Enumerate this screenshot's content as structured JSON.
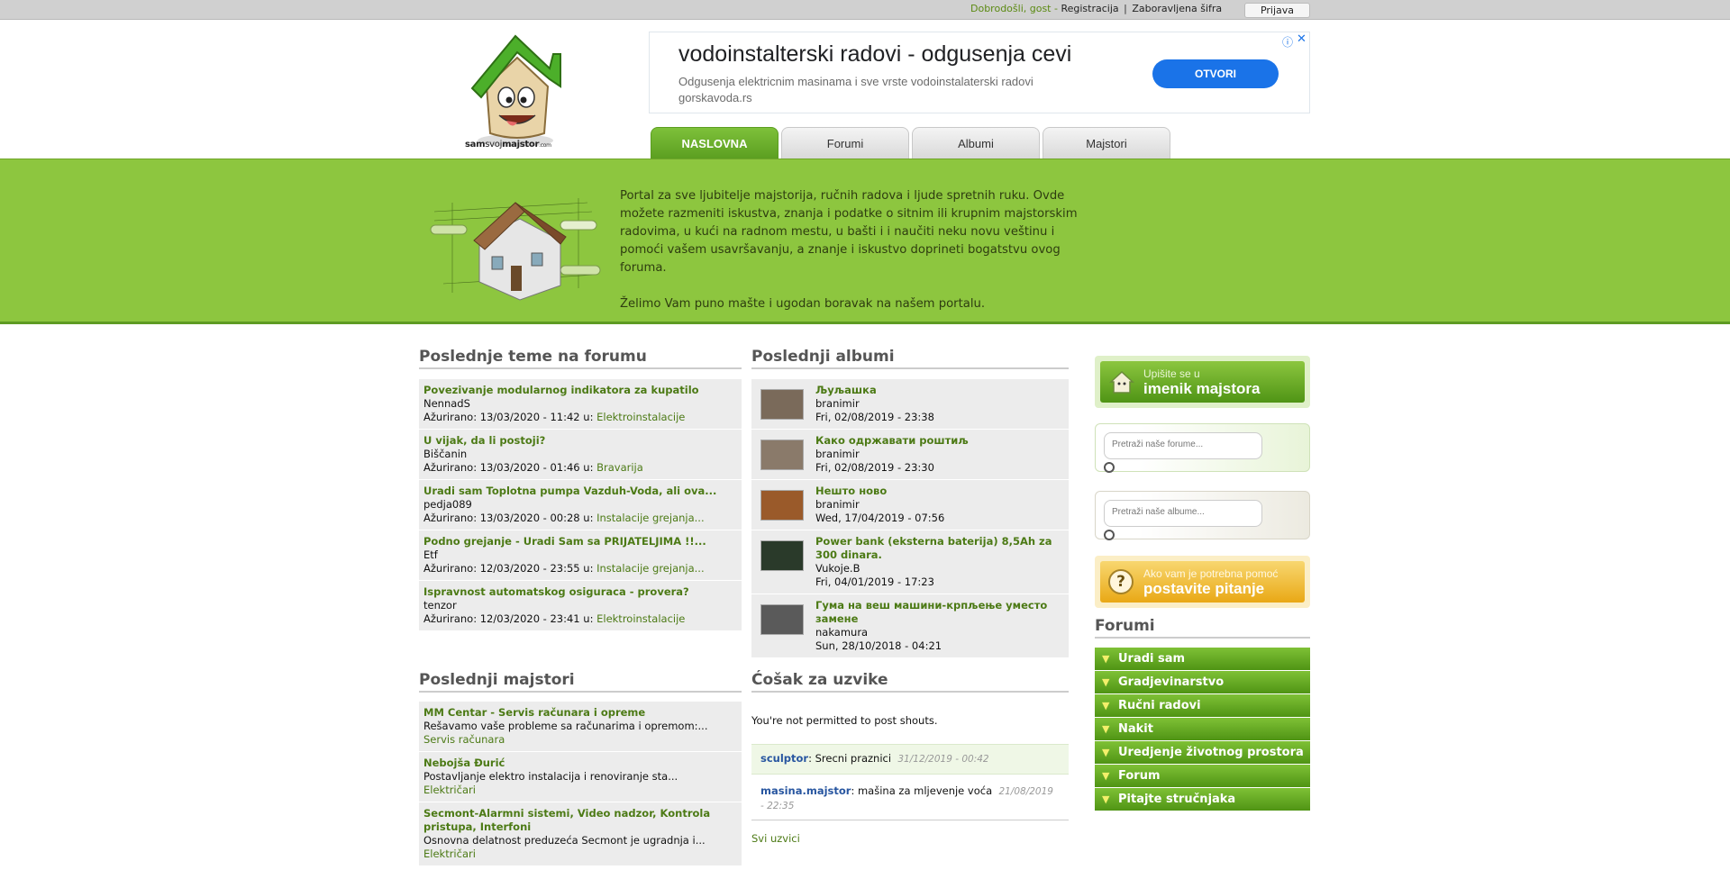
{
  "topbar": {
    "welcome": "Dobrodošli, gost -",
    "register": "Registracija",
    "separator": "|",
    "forgot": "Zaboravljena šifra",
    "login": "Prijava"
  },
  "logo": {
    "part1": "sam",
    "part2": "svoj",
    "part3": "majstor",
    "part4": ".com"
  },
  "ad": {
    "title": "vodoinstalterski radovi - odgusenja cevi",
    "description": "Odgusenja elektricnim masinama i sve vrste vodoinstalaterski radovi",
    "url": "gorskavoda.rs",
    "button": "OTVORI",
    "info_icon": "ⓘ",
    "close_icon": "✕"
  },
  "tabs": [
    "NASLOVNA",
    "Forumi",
    "Albumi",
    "Majstori"
  ],
  "intro": {
    "p1": "Portal za sve ljubitelje majstorija, ručnih radova i ljude spretnih ruku. Ovde možete razmeniti iskustva, znanja i podatke o sitnim ili krupnim majstorskim radovima, u kući na radnom mestu, u bašti i i naučiti neku novu veštinu i pomoći vašem usavršavanju, a znanje i iskustvo doprineti bogatstvu ovog foruma.",
    "p2": "Želimo Vam puno mašte i ugodan boravak na našem portalu."
  },
  "forum_topics": {
    "title": "Poslednje teme na forumu",
    "items": [
      {
        "title": "Povezivanje modularnog indikatora za kupatilo",
        "user": "NennadS",
        "updated": "Ažurirano: 13/03/2020 - 11:42 u: ",
        "category": "Elektroinstalacije"
      },
      {
        "title": "U vijak, da li postoji?",
        "user": "Biščanin",
        "updated": "Ažurirano: 13/03/2020 - 01:46 u: ",
        "category": "Bravarija"
      },
      {
        "title": "Uradi sam Toplotna pumpa Vazduh-Voda, ali ova...",
        "user": "pedja089",
        "updated": "Ažurirano: 13/03/2020 - 00:28 u: ",
        "category": "Instalacije grejanja..."
      },
      {
        "title": "Podno grejanje - Uradi Sam sa PRIJATELJIMA !!...",
        "user": "Etf",
        "updated": "Ažurirano: 12/03/2020 - 23:55 u: ",
        "category": "Instalacije grejanja..."
      },
      {
        "title": "Ispravnost automatskog osiguraca - provera?",
        "user": "tenzor",
        "updated": "Ažurirano: 12/03/2020 - 23:41 u: ",
        "category": "Elektroinstalacije"
      }
    ]
  },
  "albums": {
    "title": "Poslednji albumi",
    "items": [
      {
        "title": "Љуљашка",
        "user": "branimir",
        "date": "Fri, 02/08/2019 - 23:38",
        "thumb_color": "#7a6a5a"
      },
      {
        "title": "Како одржавати роштиљ",
        "user": "branimir",
        "date": "Fri, 02/08/2019 - 23:30",
        "thumb_color": "#8a7a6a"
      },
      {
        "title": "Нешто ново",
        "user": "branimir",
        "date": "Wed, 17/04/2019 - 07:56",
        "thumb_color": "#9a5a2a"
      },
      {
        "title": "Power bank (eksterna baterija) 8,5Ah za 300 dinara.",
        "user": "Vukoje.B",
        "date": "Fri, 04/01/2019 - 17:23",
        "thumb_color": "#2a3a2a"
      },
      {
        "title": "Гума на веш машини-крпљење уместо замене",
        "user": "nakamura",
        "date": "Sun, 28/10/2018 - 04:21",
        "thumb_color": "#5a5a5a"
      }
    ]
  },
  "craftsmen": {
    "title": "Poslednji majstori",
    "items": [
      {
        "title": "MM Centar - Servis računara i opreme",
        "desc": "Rešavamo vaše probleme sa računarima i opremom:...",
        "category": "Servis računara"
      },
      {
        "title": "Nebojša Đurić",
        "desc": "Postavljanje elektro instalacija i renoviranje sta...",
        "category": "Električari"
      },
      {
        "title": "Secmont-Alarmni sistemi, Video nadzor, Kontrola pristupa, Interfoni",
        "desc": "Osnovna delatnost preduzeća Secmont je ugradnja i...",
        "category": "Električari"
      }
    ]
  },
  "shoutbox": {
    "title": "Ćošak za uzvike",
    "notice": "You're not permitted to post shouts.",
    "shouts": [
      {
        "user": "sculptor",
        "text": ": Srecni praznici",
        "time": "31/12/2019 - 00:42"
      },
      {
        "user": "masina.majstor",
        "text": ": mašina za mljevenje voća",
        "time": "21/08/2019 - 22:35"
      }
    ],
    "all_link": "Svi uzvici"
  },
  "sidebar": {
    "directory_line1": "Upišite se u",
    "directory_line2": "imenik majstora",
    "forum_search_placeholder": "Pretraži naše forume...",
    "album_search_placeholder": "Pretraži naše albume...",
    "help_line1": "Ako vam je potrebna pomoć",
    "help_line2": "postavite pitanje",
    "forums_title": "Forumi",
    "forums": [
      "Uradi sam",
      "Gradjevinarstvo",
      "Ručni radovi",
      "Nakit",
      "Uredjenje životnog prostora",
      "Forum",
      "Pitajte stručnjaka"
    ]
  }
}
